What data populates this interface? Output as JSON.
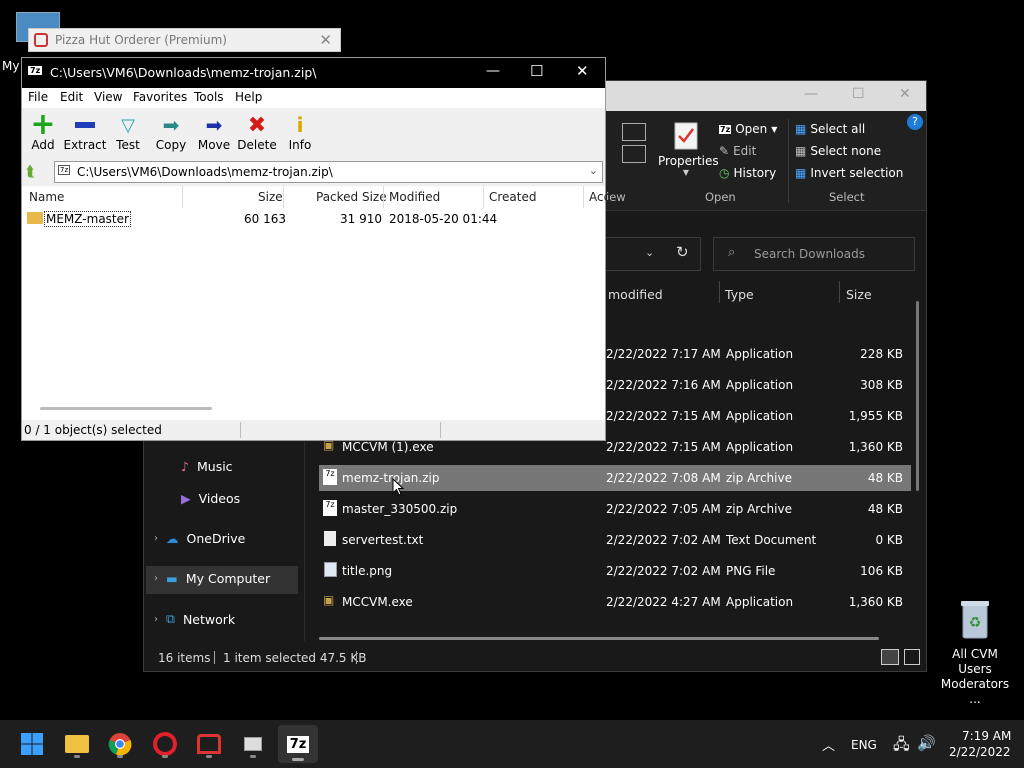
{
  "desktop": {
    "left_icon_label": "My",
    "recycle_label": "All CVM Users Moderators ..."
  },
  "pizza_window": {
    "title": "Pizza Hut Orderer (Premium)"
  },
  "explorer": {
    "ribbon": {
      "properties": "Properties",
      "open": "Open",
      "edit": "Edit",
      "history": "History",
      "select_all": "Select all",
      "select_none": "Select none",
      "invert_selection": "Invert selection",
      "group_view": "iew",
      "group_open": "Open",
      "group_select": "Select"
    },
    "search_placeholder": "Search Downloads",
    "columns": {
      "modified": "modified",
      "type": "Type",
      "size": "Size"
    },
    "rows_top": [
      {
        "date": "2/22/2022 7:17 AM",
        "type": "Application",
        "size": "228 KB"
      },
      {
        "date": "2/22/2022 7:16 AM",
        "type": "Application",
        "size": "308 KB"
      },
      {
        "date": "2/22/2022 7:15 AM",
        "type": "Application",
        "size": "1,955 KB"
      }
    ],
    "rows": [
      {
        "name": "MCCVM (1).exe",
        "date": "2/22/2022 7:15 AM",
        "type": "Application",
        "size": "1,360 KB"
      },
      {
        "name": "memz-trojan.zip",
        "date": "2/22/2022 7:08 AM",
        "type": "zip Archive",
        "size": "48 KB"
      },
      {
        "name": "master_330500.zip",
        "date": "2/22/2022 7:05 AM",
        "type": "zip Archive",
        "size": "48 KB"
      },
      {
        "name": "servertest.txt",
        "date": "2/22/2022 7:02 AM",
        "type": "Text Document",
        "size": "0 KB"
      },
      {
        "name": "title.png",
        "date": "2/22/2022 7:02 AM",
        "type": "PNG File",
        "size": "106 KB"
      },
      {
        "name": "MCCVM.exe",
        "date": "2/22/2022 4:27 AM",
        "type": "Application",
        "size": "1,360 KB"
      }
    ],
    "nav": {
      "music": "Music",
      "videos": "Videos",
      "onedrive": "OneDrive",
      "my_computer": "My Computer",
      "network": "Network"
    },
    "status": {
      "items": "16 items",
      "selected": "1 item selected  47.5 KB"
    }
  },
  "zip": {
    "title": "C:\\Users\\VM6\\Downloads\\memz-trojan.zip\\",
    "menu": [
      "File",
      "Edit",
      "View",
      "Favorites",
      "Tools",
      "Help"
    ],
    "tools": [
      "Add",
      "Extract",
      "Test",
      "Copy",
      "Move",
      "Delete",
      "Info"
    ],
    "address": "C:\\Users\\VM6\\Downloads\\memz-trojan.zip\\",
    "columns": {
      "name": "Name",
      "size": "Size",
      "packed": "Packed Size",
      "modified": "Modified",
      "created": "Created",
      "accessed": "Acc"
    },
    "row": {
      "name": "MEMZ-master",
      "size": "60 163",
      "packed": "31 910",
      "modified": "2018-05-20 01:44"
    },
    "status": "0 / 1 object(s) selected"
  },
  "taskbar": {
    "lang": "ENG",
    "time": "7:19 AM",
    "date": "2/22/2022"
  },
  "colors": {
    "folder": "#e8b84a",
    "accent": "#0078d4",
    "selected_row": "#777777"
  }
}
